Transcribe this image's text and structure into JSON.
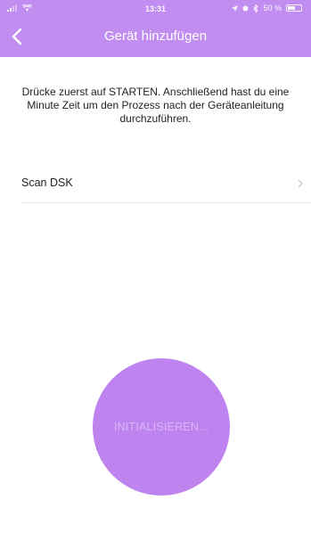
{
  "status_bar": {
    "time": "13:31",
    "battery_text": "50 %",
    "battery_level": 0.5
  },
  "nav": {
    "title": "Gerät hinzufügen",
    "back_icon": "chevron-left-icon"
  },
  "instructions": "Drücke zuerst auf STARTEN. Anschließend hast du eine Minute Zeit um den Prozess nach der Geräteanleitung durchzuführen.",
  "list": {
    "scan_dsk_label": "Scan DSK",
    "chevron_icon": "chevron-right-icon"
  },
  "action_button": {
    "label": "INITIALISIEREN..."
  },
  "colors": {
    "header": "#c18df0",
    "button": "#bf83f0",
    "button_text": "#d9b8f5"
  }
}
